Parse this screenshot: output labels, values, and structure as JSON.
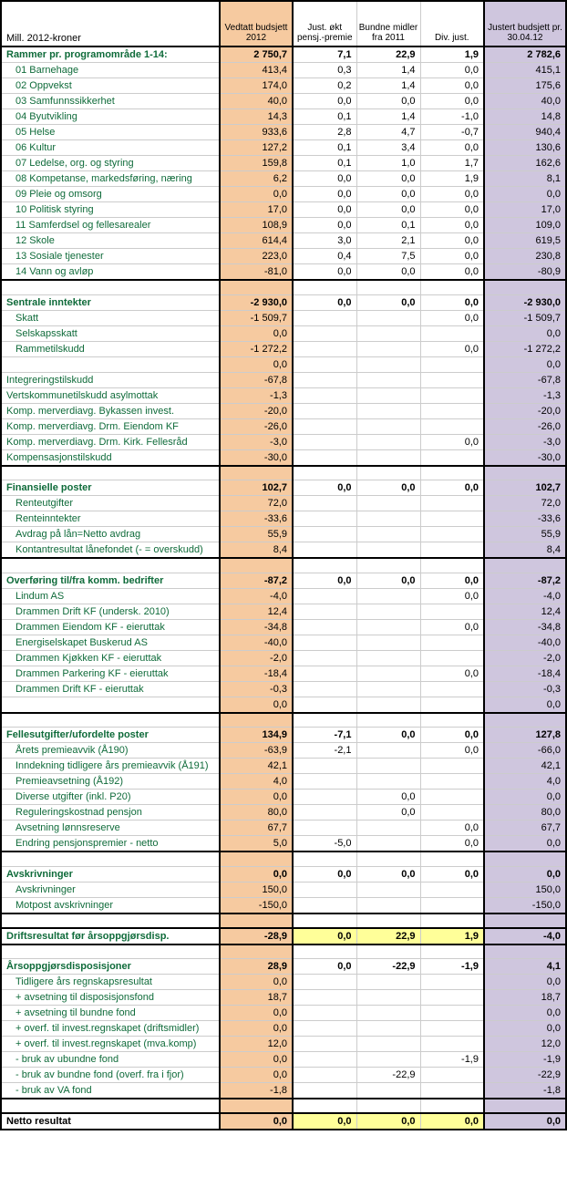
{
  "headers": {
    "label": "Mill. 2012-kroner",
    "vedtatt": "Vedtatt budsjett 2012",
    "just_pensj": "Just. økt pensj.-premie",
    "bundne": "Bundne midler fra 2011",
    "divjust": "Div. just.",
    "justert": "Justert budsjett pr. 30.04.12"
  },
  "sections": [
    {
      "label": "Rammer pr. programområde 1-14:",
      "v1": "2 750,7",
      "v2": "7,1",
      "v3": "22,9",
      "v4": "1,9",
      "v5": "2 782,6",
      "topBorder": true,
      "rows": [
        {
          "label": "01 Barnehage",
          "v1": "413,4",
          "v2": "0,3",
          "v3": "1,4",
          "v4": "0,0",
          "v5": "415,1"
        },
        {
          "label": "02 Oppvekst",
          "v1": "174,0",
          "v2": "0,2",
          "v3": "1,4",
          "v4": "0,0",
          "v5": "175,6"
        },
        {
          "label": "03 Samfunnssikkerhet",
          "v1": "40,0",
          "v2": "0,0",
          "v3": "0,0",
          "v4": "0,0",
          "v5": "40,0"
        },
        {
          "label": "04 Byutvikling",
          "v1": "14,3",
          "v2": "0,1",
          "v3": "1,4",
          "v4": "-1,0",
          "v5": "14,8"
        },
        {
          "label": "05 Helse",
          "v1": "933,6",
          "v2": "2,8",
          "v3": "4,7",
          "v4": "-0,7",
          "v5": "940,4"
        },
        {
          "label": "06 Kultur",
          "v1": "127,2",
          "v2": "0,1",
          "v3": "3,4",
          "v4": "0,0",
          "v5": "130,6"
        },
        {
          "label": "07 Ledelse, org. og styring",
          "v1": "159,8",
          "v2": "0,1",
          "v3": "1,0",
          "v4": "1,7",
          "v5": "162,6"
        },
        {
          "label": "08 Kompetanse, markedsføring, næring",
          "v1": "6,2",
          "v2": "0,0",
          "v3": "0,0",
          "v4": "1,9",
          "v5": "8,1"
        },
        {
          "label": "09 Pleie og omsorg",
          "v1": "0,0",
          "v2": "0,0",
          "v3": "0,0",
          "v4": "0,0",
          "v5": "0,0"
        },
        {
          "label": "10 Politisk styring",
          "v1": "17,0",
          "v2": "0,0",
          "v3": "0,0",
          "v4": "0,0",
          "v5": "17,0"
        },
        {
          "label": "11 Samferdsel og fellesarealer",
          "v1": "108,9",
          "v2": "0,0",
          "v3": "0,1",
          "v4": "0,0",
          "v5": "109,0"
        },
        {
          "label": "12 Skole",
          "v1": "614,4",
          "v2": "3,0",
          "v3": "2,1",
          "v4": "0,0",
          "v5": "619,5"
        },
        {
          "label": "13 Sosiale tjenester",
          "v1": "223,0",
          "v2": "0,4",
          "v3": "7,5",
          "v4": "0,0",
          "v5": "230,8"
        },
        {
          "label": "14 Vann og avløp",
          "v1": "-81,0",
          "v2": "0,0",
          "v3": "0,0",
          "v4": "0,0",
          "v5": "-80,9",
          "bottomBorder": true
        }
      ]
    },
    {
      "label": "Sentrale inntekter",
      "v1": "-2 930,0",
      "v2": "0,0",
      "v3": "0,0",
      "v4": "0,0",
      "v5": "-2 930,0",
      "spaceBefore": true,
      "rows": [
        {
          "label": "Skatt",
          "v1": "-1 509,7",
          "v2": "",
          "v3": "",
          "v4": "0,0",
          "v5": "-1 509,7"
        },
        {
          "label": "Selskapsskatt",
          "v1": "0,0",
          "v2": "",
          "v3": "",
          "v4": "",
          "v5": "0,0"
        },
        {
          "label": "Rammetilskudd",
          "v1": "-1 272,2",
          "v2": "",
          "v3": "",
          "v4": "0,0",
          "v5": "-1 272,2"
        },
        {
          "label": "",
          "v1": "0,0",
          "v2": "",
          "v3": "",
          "v4": "",
          "v5": "0,0",
          "noindent": true
        },
        {
          "label": "Integreringstilskudd",
          "v1": "-67,8",
          "v2": "",
          "v3": "",
          "v4": "",
          "v5": "-67,8",
          "noindent": true
        },
        {
          "label": "Vertskommunetilskudd asylmottak",
          "v1": "-1,3",
          "v2": "",
          "v3": "",
          "v4": "",
          "v5": "-1,3",
          "noindent": true
        },
        {
          "label": "Komp. merverdiavg. Bykassen invest.",
          "v1": "-20,0",
          "v2": "",
          "v3": "",
          "v4": "",
          "v5": "-20,0",
          "noindent": true
        },
        {
          "label": "Komp. merverdiavg. Drm. Eiendom KF",
          "v1": "-26,0",
          "v2": "",
          "v3": "",
          "v4": "",
          "v5": "-26,0",
          "noindent": true
        },
        {
          "label": "Komp. merverdiavg. Drm. Kirk. Fellesråd",
          "v1": "-3,0",
          "v2": "",
          "v3": "",
          "v4": "0,0",
          "v5": "-3,0",
          "noindent": true
        },
        {
          "label": "Kompensasjonstilskudd",
          "v1": "-30,0",
          "v2": "",
          "v3": "",
          "v4": "",
          "v5": "-30,0",
          "noindent": true,
          "bottomBorder": true
        }
      ]
    },
    {
      "label": "Finansielle poster",
      "v1": "102,7",
      "v2": "0,0",
      "v3": "0,0",
      "v4": "0,0",
      "v5": "102,7",
      "spaceBefore": true,
      "rows": [
        {
          "label": "Renteutgifter",
          "v1": "72,0",
          "v2": "",
          "v3": "",
          "v4": "",
          "v5": "72,0"
        },
        {
          "label": "Renteinntekter",
          "v1": "-33,6",
          "v2": "",
          "v3": "",
          "v4": "",
          "v5": "-33,6"
        },
        {
          "label": "Avdrag på lån=Netto avdrag",
          "v1": "55,9",
          "v2": "",
          "v3": "",
          "v4": "",
          "v5": "55,9"
        },
        {
          "label": "Kontantresultat lånefondet (- = overskudd)",
          "v1": "8,4",
          "v2": "",
          "v3": "",
          "v4": "",
          "v5": "8,4",
          "bottomBorder": true
        }
      ]
    },
    {
      "label": "Overføring til/fra komm. bedrifter",
      "v1": "-87,2",
      "v2": "0,0",
      "v3": "0,0",
      "v4": "0,0",
      "v5": "-87,2",
      "spaceBefore": true,
      "rows": [
        {
          "label": "Lindum AS",
          "v1": "-4,0",
          "v2": "",
          "v3": "",
          "v4": "0,0",
          "v5": "-4,0"
        },
        {
          "label": "Drammen Drift KF (undersk. 2010)",
          "v1": "12,4",
          "v2": "",
          "v3": "",
          "v4": "",
          "v5": "12,4"
        },
        {
          "label": "Drammen Eiendom KF - eieruttak",
          "v1": "-34,8",
          "v2": "",
          "v3": "",
          "v4": "0,0",
          "v5": "-34,8"
        },
        {
          "label": "Energiselskapet Buskerud AS",
          "v1": "-40,0",
          "v2": "",
          "v3": "",
          "v4": "",
          "v5": "-40,0"
        },
        {
          "label": "Drammen Kjøkken KF - eieruttak",
          "v1": "-2,0",
          "v2": "",
          "v3": "",
          "v4": "",
          "v5": "-2,0"
        },
        {
          "label": "Drammen Parkering KF - eieruttak",
          "v1": "-18,4",
          "v2": "",
          "v3": "",
          "v4": "0,0",
          "v5": "-18,4"
        },
        {
          "label": "Drammen Drift KF - eieruttak",
          "v1": "-0,3",
          "v2": "",
          "v3": "",
          "v4": "",
          "v5": "-0,3"
        },
        {
          "label": "",
          "v1": "0,0",
          "v2": "",
          "v3": "",
          "v4": "",
          "v5": "0,0",
          "bottomBorder": true
        }
      ]
    },
    {
      "label": "Fellesutgifter/ufordelte poster",
      "v1": "134,9",
      "v2": "-7,1",
      "v3": "0,0",
      "v4": "0,0",
      "v5": "127,8",
      "spaceBefore": true,
      "rows": [
        {
          "label": "Årets premieavvik (Å190)",
          "v1": "-63,9",
          "v2": "-2,1",
          "v3": "",
          "v4": "0,0",
          "v5": "-66,0"
        },
        {
          "label": "Inndekning tidligere års premieavvik (Å191)",
          "v1": "42,1",
          "v2": "",
          "v3": "",
          "v4": "",
          "v5": "42,1"
        },
        {
          "label": "Premieavsetning (Å192)",
          "v1": "4,0",
          "v2": "",
          "v3": "",
          "v4": "",
          "v5": "4,0"
        },
        {
          "label": "Diverse utgifter (inkl. P20)",
          "v1": "0,0",
          "v2": "",
          "v3": "0,0",
          "v4": "",
          "v5": "0,0"
        },
        {
          "label": "Reguleringskostnad pensjon",
          "v1": "80,0",
          "v2": "",
          "v3": "0,0",
          "v4": "",
          "v5": "80,0"
        },
        {
          "label": "Avsetning lønnsreserve",
          "v1": "67,7",
          "v2": "",
          "v3": "",
          "v4": "0,0",
          "v5": "67,7"
        },
        {
          "label": "Endring pensjonspremier - netto",
          "v1": "5,0",
          "v2": "-5,0",
          "v3": "",
          "v4": "0,0",
          "v5": "0,0",
          "bottomBorder": true
        }
      ]
    },
    {
      "label": "Avskrivninger",
      "v1": "0,0",
      "v2": "0,0",
      "v3": "0,0",
      "v4": "0,0",
      "v5": "0,0",
      "spaceBefore": true,
      "rows": [
        {
          "label": "Avskrivninger",
          "v1": "150,0",
          "v2": "",
          "v3": "",
          "v4": "",
          "v5": "150,0"
        },
        {
          "label": "Motpost avskrivninger",
          "v1": "-150,0",
          "v2": "",
          "v3": "",
          "v4": "",
          "v5": "-150,0",
          "bottomBorder": true
        }
      ]
    }
  ],
  "drifts": {
    "label": "Driftsresultat før årsoppgjørsdisp.",
    "v1": "-28,9",
    "v2": "0,0",
    "v3": "22,9",
    "v4": "1,9",
    "v5": "-4,0"
  },
  "arsoppgjor": {
    "label": "Årsoppgjørsdisposisjoner",
    "v1": "28,9",
    "v2": "0,0",
    "v3": "-22,9",
    "v4": "-1,9",
    "v5": "4,1",
    "rows": [
      {
        "label": "Tidligere års regnskapsresultat",
        "v1": "0,0",
        "v2": "",
        "v3": "",
        "v4": "",
        "v5": "0,0"
      },
      {
        "label": "+ avsetning til disposisjonsfond",
        "v1": "18,7",
        "v2": "",
        "v3": "",
        "v4": "",
        "v5": "18,7"
      },
      {
        "label": "+ avsetning til bundne fond",
        "v1": "0,0",
        "v2": "",
        "v3": "",
        "v4": "",
        "v5": "0,0"
      },
      {
        "label": "+ overf. til invest.regnskapet (driftsmidler)",
        "v1": "0,0",
        "v2": "",
        "v3": "",
        "v4": "",
        "v5": "0,0"
      },
      {
        "label": "+ overf. til invest.regnskapet (mva.komp)",
        "v1": "12,0",
        "v2": "",
        "v3": "",
        "v4": "",
        "v5": "12,0"
      },
      {
        "label": " - bruk av ubundne fond",
        "v1": "0,0",
        "v2": "",
        "v3": "",
        "v4": "-1,9",
        "v5": "-1,9"
      },
      {
        "label": " - bruk av bundne fond (overf. fra i fjor)",
        "v1": "0,0",
        "v2": "",
        "v3": "-22,9",
        "v4": "",
        "v5": "-22,9"
      },
      {
        "label": " - bruk av VA fond",
        "v1": "-1,8",
        "v2": "",
        "v3": "",
        "v4": "",
        "v5": "-1,8",
        "bottomBorder": true
      }
    ]
  },
  "netto": {
    "label": "Netto resultat",
    "v1": "0,0",
    "v2": "0,0",
    "v3": "0,0",
    "v4": "0,0",
    "v5": "0,0"
  }
}
